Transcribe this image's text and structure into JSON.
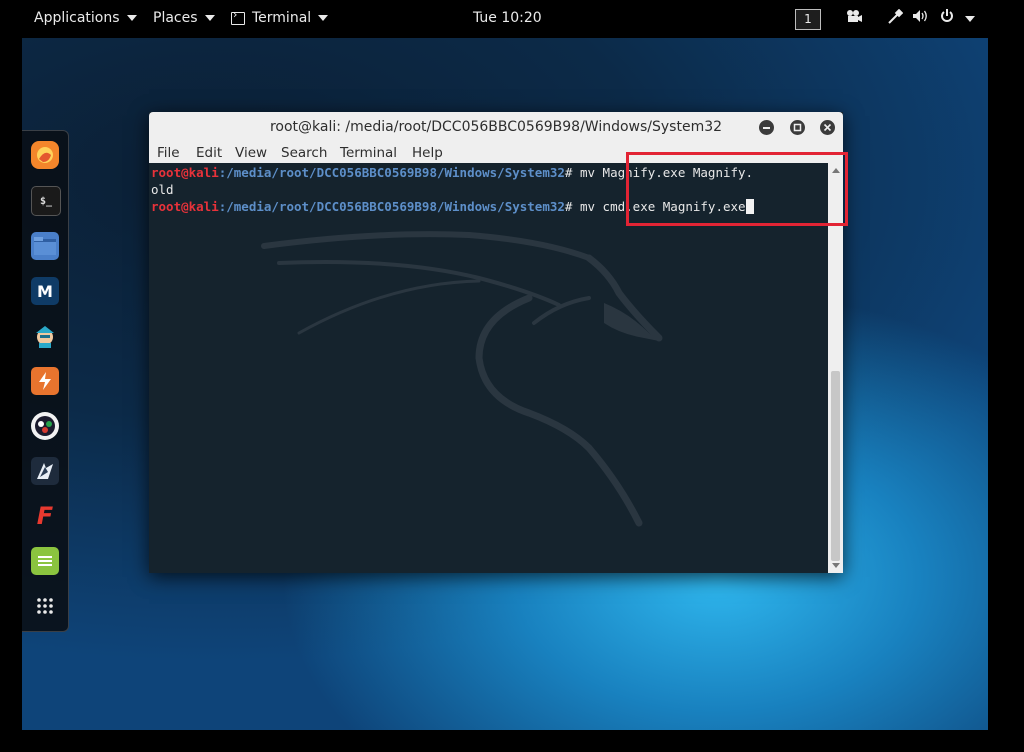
{
  "topbar": {
    "applications": "Applications",
    "places": "Places",
    "terminal": "Terminal",
    "clock": "Tue 10:20",
    "workspace": "1"
  },
  "dock": {
    "items": [
      "firefox-icon",
      "terminal-app-icon",
      "files-icon",
      "metasploit-icon",
      "armitage-icon",
      "burpsuite-icon",
      "maltego-icon",
      "beef-icon",
      "faraday-icon",
      "leafpad-icon",
      "show-apps-icon"
    ]
  },
  "window": {
    "title": "root@kali: /media/root/DCC056BBC0569B98/Windows/System32",
    "menu": [
      "File",
      "Edit",
      "View",
      "Search",
      "Terminal",
      "Help"
    ]
  },
  "terminal": {
    "user": "root@kali",
    "path": ":/media/root/DCC056BBC0569B98/Windows/System32",
    "prompt_suffix": "# ",
    "cmd1": "mv Magnify.exe Magnify.",
    "cmd1_wrap": "old",
    "cmd2": "mv cmd.exe Magnify.exe"
  },
  "colors": {
    "prompt_user": "#e8323a",
    "prompt_path": "#5d8fc9",
    "highlight_box": "#e22434",
    "terminal_bg": "#15232d"
  }
}
